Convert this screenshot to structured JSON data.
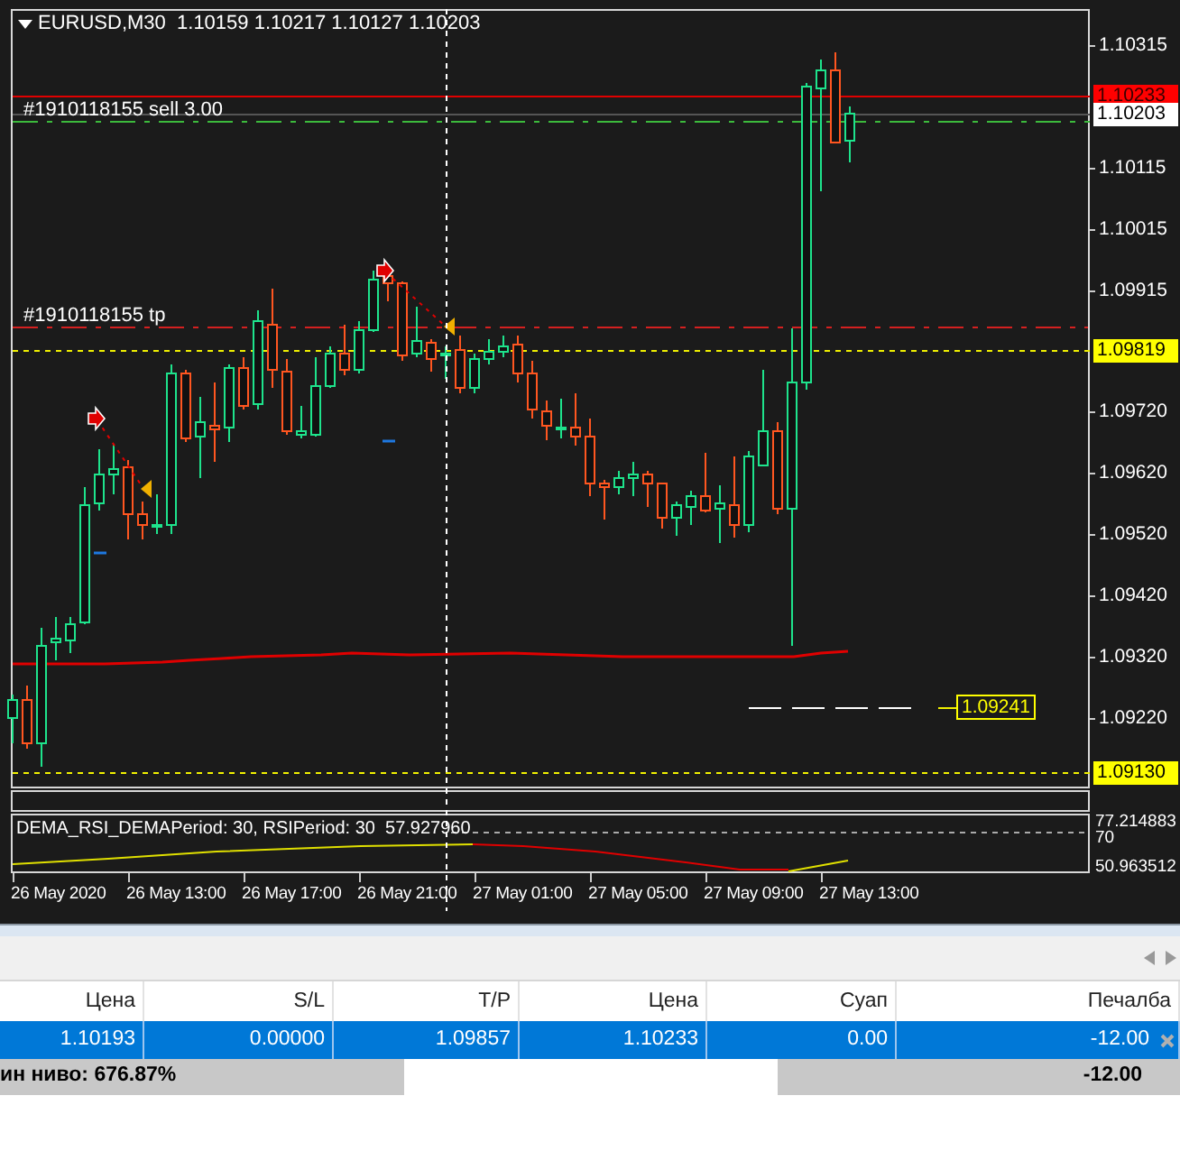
{
  "chart": {
    "symbol_header": "EURUSD,M30  1.10159 1.10217 1.10127 1.10203",
    "order_labels": [
      "#1910118155 sell 3.00",
      "#1910118155 tp"
    ],
    "price_axis": [
      "1.10315",
      "1.10115",
      "1.10015",
      "1.09915",
      "1.09720",
      "1.09620",
      "1.09520",
      "1.09420",
      "1.09320",
      "1.09220"
    ],
    "price_tags": [
      {
        "text": "1.10233",
        "kind": "ask"
      },
      {
        "text": "1.10203",
        "kind": "bid"
      },
      {
        "text": "1.09819",
        "kind": "level"
      },
      {
        "text": "1.09130",
        "kind": "level"
      }
    ],
    "floating_tag": "1.09241"
  },
  "indicator": {
    "label": "DEMA_RSI_DEMAPeriod: 30, RSIPeriod: 30  57.927960",
    "axis": [
      "77.214883",
      "70",
      "50.963512"
    ]
  },
  "time_axis": [
    "26 May 2020",
    "26 May 13:00",
    "26 May 17:00",
    "26 May 21:00",
    "27 May 01:00",
    "27 May 05:00",
    "27 May 09:00",
    "27 May 13:00"
  ],
  "trade_table": {
    "columns": [
      "Цена",
      "S/L",
      "T/P",
      "Цена",
      "Суап",
      "Печалба"
    ],
    "rows": [
      {
        "cells": [
          "1.10193",
          "0.00000",
          "1.09857",
          "1.10233",
          "0.00",
          "-12.00"
        ],
        "selected": true
      }
    ],
    "footer": {
      "margin_level": "ин ниво: 676.87%",
      "total": "-12.00"
    }
  }
}
